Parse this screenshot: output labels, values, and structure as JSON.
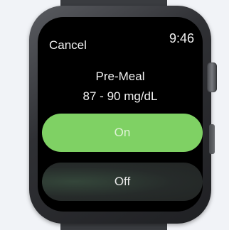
{
  "status_bar": {
    "cancel_label": "Cancel",
    "time": "9:46"
  },
  "reminder": {
    "title": "Pre-Meal",
    "range": "87 - 90 mg/dL"
  },
  "actions": {
    "on_label": "On",
    "off_label": "Off"
  },
  "colors": {
    "on_button": "#7fd164",
    "off_button": "#262b2a",
    "screen": "#000000"
  }
}
